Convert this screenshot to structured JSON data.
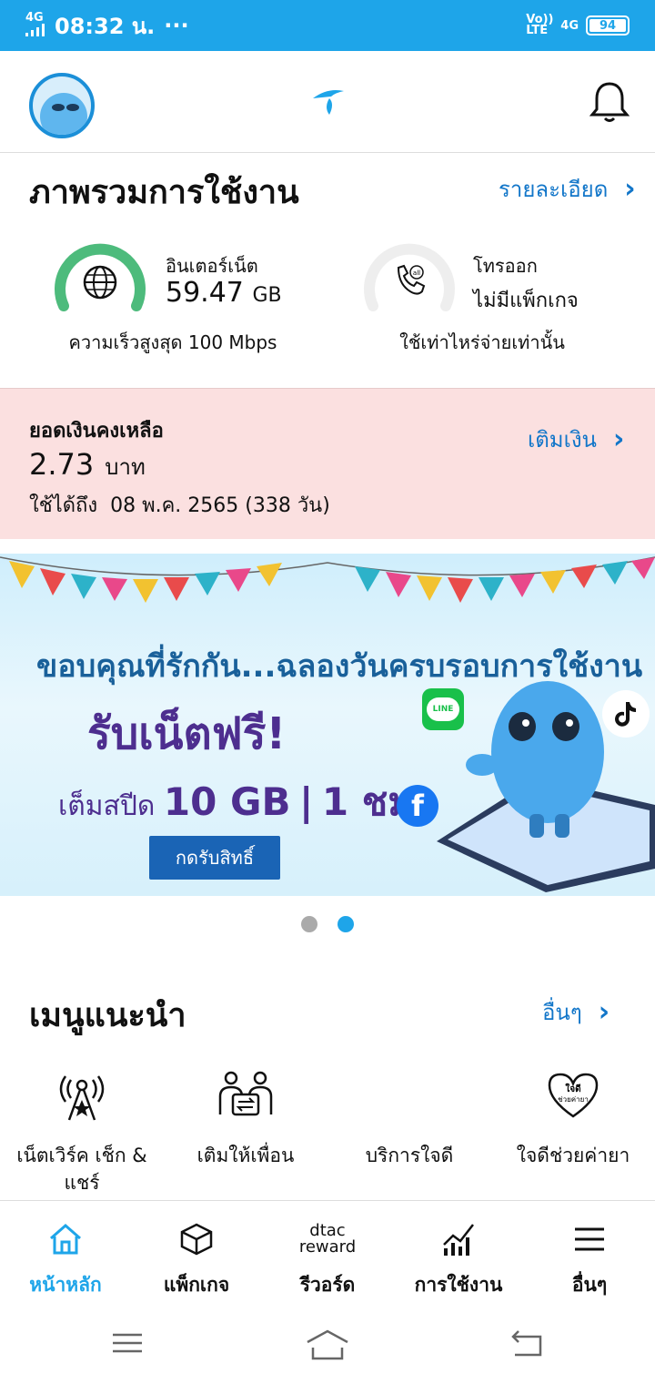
{
  "status_bar": {
    "time": "08:32 น.",
    "more": "···",
    "network": "4G",
    "volte": "Vo)) LTE",
    "network2": "4G",
    "battery": "94"
  },
  "header": {
    "avatar": "avatar",
    "logo": "dtac-logo",
    "notification": "bell-icon"
  },
  "overview": {
    "title": "ภาพรวมการใช้งาน",
    "details_link": "รายละเอียด",
    "internet": {
      "label": "อินเตอร์เน็ต",
      "value": "59.47",
      "unit": "GB",
      "sub": "ความเร็วสูงสุด 100 Mbps",
      "level": 1.0
    },
    "call": {
      "label": "โทรออก",
      "value": "ไม่มีแพ็กเกจ",
      "sub": "ใช้เท่าไหร่จ่ายเท่านั้น",
      "level": 0.0
    }
  },
  "balance": {
    "title": "ยอดเงินคงเหลือ",
    "amount": "2.73",
    "currency": "บาท",
    "valid_label": "ใช้ได้ถึง",
    "valid_date": "08 พ.ค. 2565 (338 วัน)",
    "topup_link": "เติมเงิน"
  },
  "banner": {
    "line1": "ขอบคุณที่รักกัน...ฉลองวันครบรอบการใช้งาน",
    "line2": "รับเน็ตฟรี!",
    "line3_prefix": "เต็มสปีด",
    "line3_amount": "10 GB",
    "line3_sep": "|",
    "line3_time": "1 ชม.",
    "button": "กดรับสิทธิ์",
    "line_icon": "LINE"
  },
  "carousel": {
    "count": 2,
    "active": 2
  },
  "menu": {
    "title": "เมนูแนะนำ",
    "more_link": "อื่นๆ",
    "items": [
      {
        "label": "เน็ตเวิร์ค เช็ก & แชร์",
        "icon": "network-tower-icon"
      },
      {
        "label": "เติมให้เพื่อน",
        "icon": "topup-friend-icon"
      },
      {
        "label": "บริการใจดี",
        "icon": "blank"
      },
      {
        "label": "ใจดีช่วยค่ายา",
        "icon": "jaidee-heart-icon",
        "badge": "ใจดี ช่วยค่ายา"
      }
    ]
  },
  "bottom_nav": {
    "items": [
      {
        "label": "หน้าหลัก",
        "icon": "home-icon",
        "active": true
      },
      {
        "label": "แพ็กเกจ",
        "icon": "box-icon"
      },
      {
        "label": "รีวอร์ด",
        "icon": "dtac-reward-icon",
        "logo_top": "dtac",
        "logo_bottom": "reward"
      },
      {
        "label": "การใช้งาน",
        "icon": "usage-chart-icon"
      },
      {
        "label": "อื่นๆ",
        "icon": "menu-icon"
      }
    ]
  },
  "colors": {
    "primary": "#1ea5e9",
    "link": "#1276c9",
    "balance_bg": "#fbe0e0",
    "gauge_green": "#4dbb7c"
  }
}
